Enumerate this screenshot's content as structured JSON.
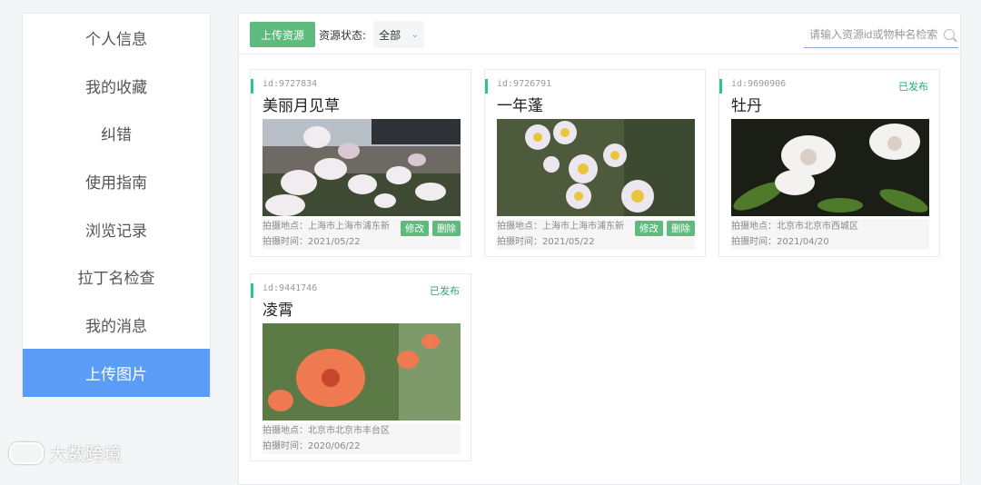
{
  "sidebar": {
    "items": [
      {
        "label": "个人信息"
      },
      {
        "label": "我的收藏"
      },
      {
        "label": "纠错"
      },
      {
        "label": "使用指南"
      },
      {
        "label": "浏览记录"
      },
      {
        "label": "拉丁名检查"
      },
      {
        "label": "我的消息"
      },
      {
        "label": "上传图片",
        "active": true
      }
    ]
  },
  "toolbar": {
    "upload_label": "上传资源",
    "status_label": "资源状态:",
    "status_value": "全部",
    "search_placeholder": "请输入资源id或物种名检索"
  },
  "cards": [
    {
      "id": "id:9727834",
      "title": "美丽月见草",
      "published": "",
      "location": "拍摄地点：上海市上海市浦东新",
      "date": "拍摄时间：2021/05/22",
      "edit": "修改",
      "delete": "删除",
      "icon": "evening-primrose-photo"
    },
    {
      "id": "id:9726791",
      "title": "一年蓬",
      "published": "",
      "location": "拍摄地点：上海市上海市浦东新",
      "date": "拍摄时间：2021/05/22",
      "edit": "修改",
      "delete": "删除",
      "icon": "fleabane-photo"
    },
    {
      "id": "id:9690906",
      "title": "牡丹",
      "published": "已发布",
      "location": "拍摄地点：北京市北京市西城区",
      "date": "拍摄时间：2021/04/20",
      "icon": "peony-photo"
    },
    {
      "id": "id:9441746",
      "title": "凌霄",
      "published": "已发布",
      "location": "拍摄地点：北京市北京市丰台区",
      "date": "拍摄时间：2020/06/22",
      "icon": "trumpet-creeper-photo"
    }
  ],
  "watermark": "大数跨境",
  "colors": {
    "accent": "#5b9cf6",
    "green": "#5fba7d",
    "published": "#2aa876"
  }
}
